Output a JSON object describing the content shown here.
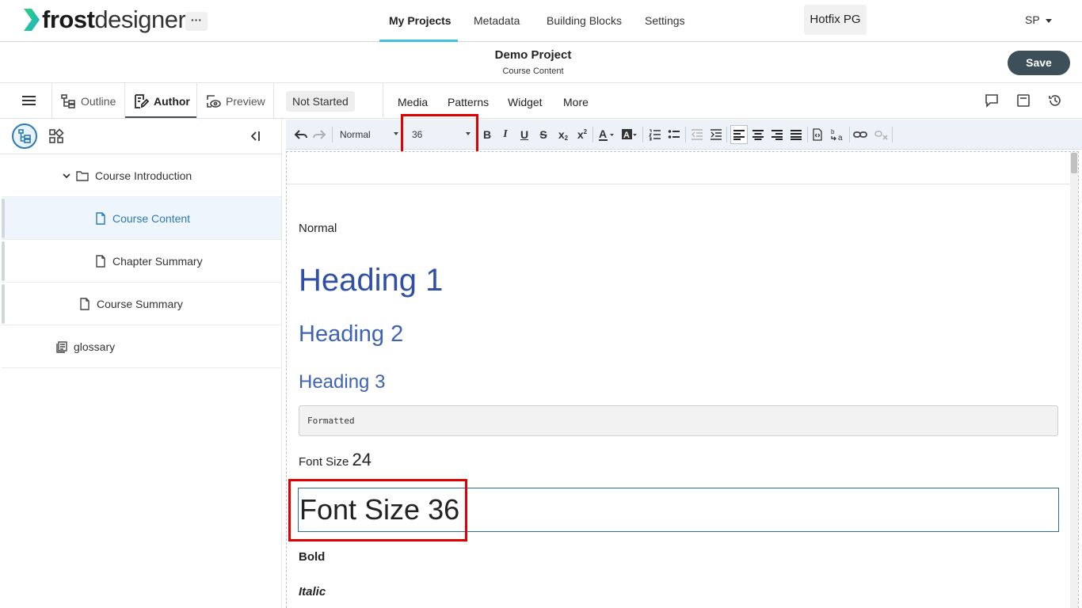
{
  "app": {
    "logo_bold": "frost",
    "logo_light": "designer",
    "more_label": "···",
    "org": "Hotfix PG",
    "user": "SP"
  },
  "nav": {
    "items": [
      "My Projects",
      "Metadata",
      "Building Blocks",
      "Settings"
    ],
    "active": "My Projects"
  },
  "project": {
    "title": "Demo Project",
    "subtitle": "Course Content",
    "save_label": "Save"
  },
  "modes": {
    "outline": "Outline",
    "author": "Author",
    "preview": "Preview",
    "status": "Not Started",
    "menu": [
      "Media",
      "Patterns",
      "Widget",
      "More"
    ]
  },
  "tree": {
    "items": [
      {
        "label": "Course Introduction",
        "type": "folder",
        "expanded": true
      },
      {
        "label": "Course Content",
        "type": "page",
        "selected": true
      },
      {
        "label": "Chapter Summary",
        "type": "page"
      },
      {
        "label": "Course Summary",
        "type": "page"
      },
      {
        "label": "glossary",
        "type": "glossary"
      }
    ]
  },
  "toolbar": {
    "paragraph_format": "Normal",
    "font_size": "36"
  },
  "content": {
    "normal": "Normal",
    "heading1": "Heading 1",
    "heading2": "Heading 2",
    "heading3": "Heading 3",
    "formatted": "Formatted",
    "fontsize24_prefix": "Font Size ",
    "fontsize24_value": "24",
    "fontsize36": "Font Size 36",
    "bold": "Bold",
    "italic": "Italic"
  },
  "colors": {
    "accent": "#3fc2e0",
    "primary_dark": "#3d4f58",
    "heading": "#2f4fa8",
    "selection_blue": "#2a79b8",
    "highlight_red": "#e00000",
    "logo_green": "#25c16f"
  }
}
